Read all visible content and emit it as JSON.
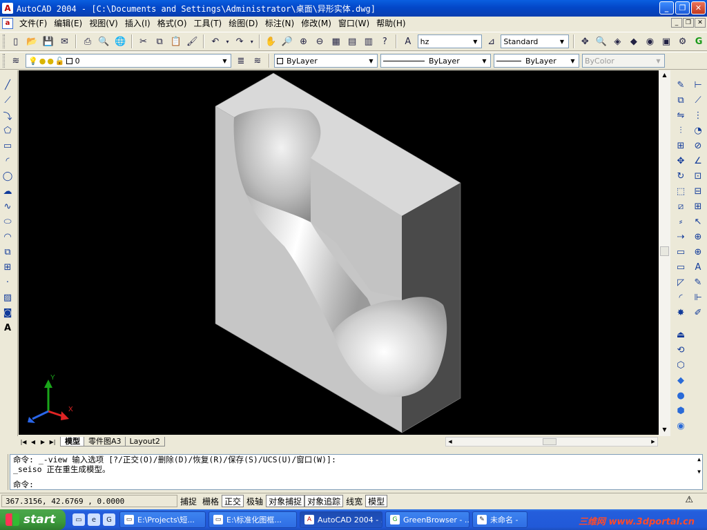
{
  "titlebar": {
    "title": "AutoCAD 2004 - [C:\\Documents and Settings\\Administrator\\桌面\\异形实体.dwg]",
    "app_icon": "A",
    "buttons": {
      "minimize": "_",
      "restore": "❐",
      "close": "✕"
    }
  },
  "menubar": {
    "items": [
      {
        "label": "文件(F)"
      },
      {
        "label": "编辑(E)"
      },
      {
        "label": "视图(V)"
      },
      {
        "label": "插入(I)"
      },
      {
        "label": "格式(O)"
      },
      {
        "label": "工具(T)"
      },
      {
        "label": "绘图(D)"
      },
      {
        "label": "标注(N)"
      },
      {
        "label": "修改(M)"
      },
      {
        "label": "窗口(W)"
      },
      {
        "label": "帮助(H)"
      }
    ]
  },
  "toolbar1": {
    "text_style": "hz",
    "dim_style": "Standard"
  },
  "toolbar2": {
    "layer": "0",
    "color": "ByLayer",
    "linetype": "ByLayer",
    "lineweight": "ByLayer",
    "plotstyle": "ByColor"
  },
  "ucs": {
    "y_label": "Y",
    "x_label": "X"
  },
  "layout_tabs": [
    {
      "label": "模型",
      "active": true
    },
    {
      "label": "零件图A3",
      "active": false
    },
    {
      "label": "Layout2",
      "active": false
    }
  ],
  "command": {
    "line1": "命令: _-view 输入选项 [?/正交(O)/删除(D)/恢复(R)/保存(S)/UCS(U)/窗口(W)]:",
    "line2": "_seiso 正在重生成模型。",
    "prompt": "命令:"
  },
  "status": {
    "coords": "367.3156, 42.6769 , 0.0000",
    "toggles": [
      {
        "label": "捕捉",
        "on": false
      },
      {
        "label": "栅格",
        "on": false
      },
      {
        "label": "正交",
        "on": true
      },
      {
        "label": "极轴",
        "on": false
      },
      {
        "label": "对象捕捉",
        "on": true
      },
      {
        "label": "对象追踪",
        "on": true
      },
      {
        "label": "线宽",
        "on": false
      },
      {
        "label": "模型",
        "on": true
      }
    ]
  },
  "taskbar": {
    "start_label": "start",
    "tasks": [
      {
        "label": "E:\\Projects\\短...",
        "active": false
      },
      {
        "label": "E:\\标准化图框...",
        "active": false
      },
      {
        "label": "AutoCAD 2004 - ...",
        "active": true
      },
      {
        "label": "GreenBrowser - ...",
        "active": false
      },
      {
        "label": "未命名 -",
        "active": false
      }
    ],
    "watermark": "三维网 www.3dportal.cn"
  }
}
